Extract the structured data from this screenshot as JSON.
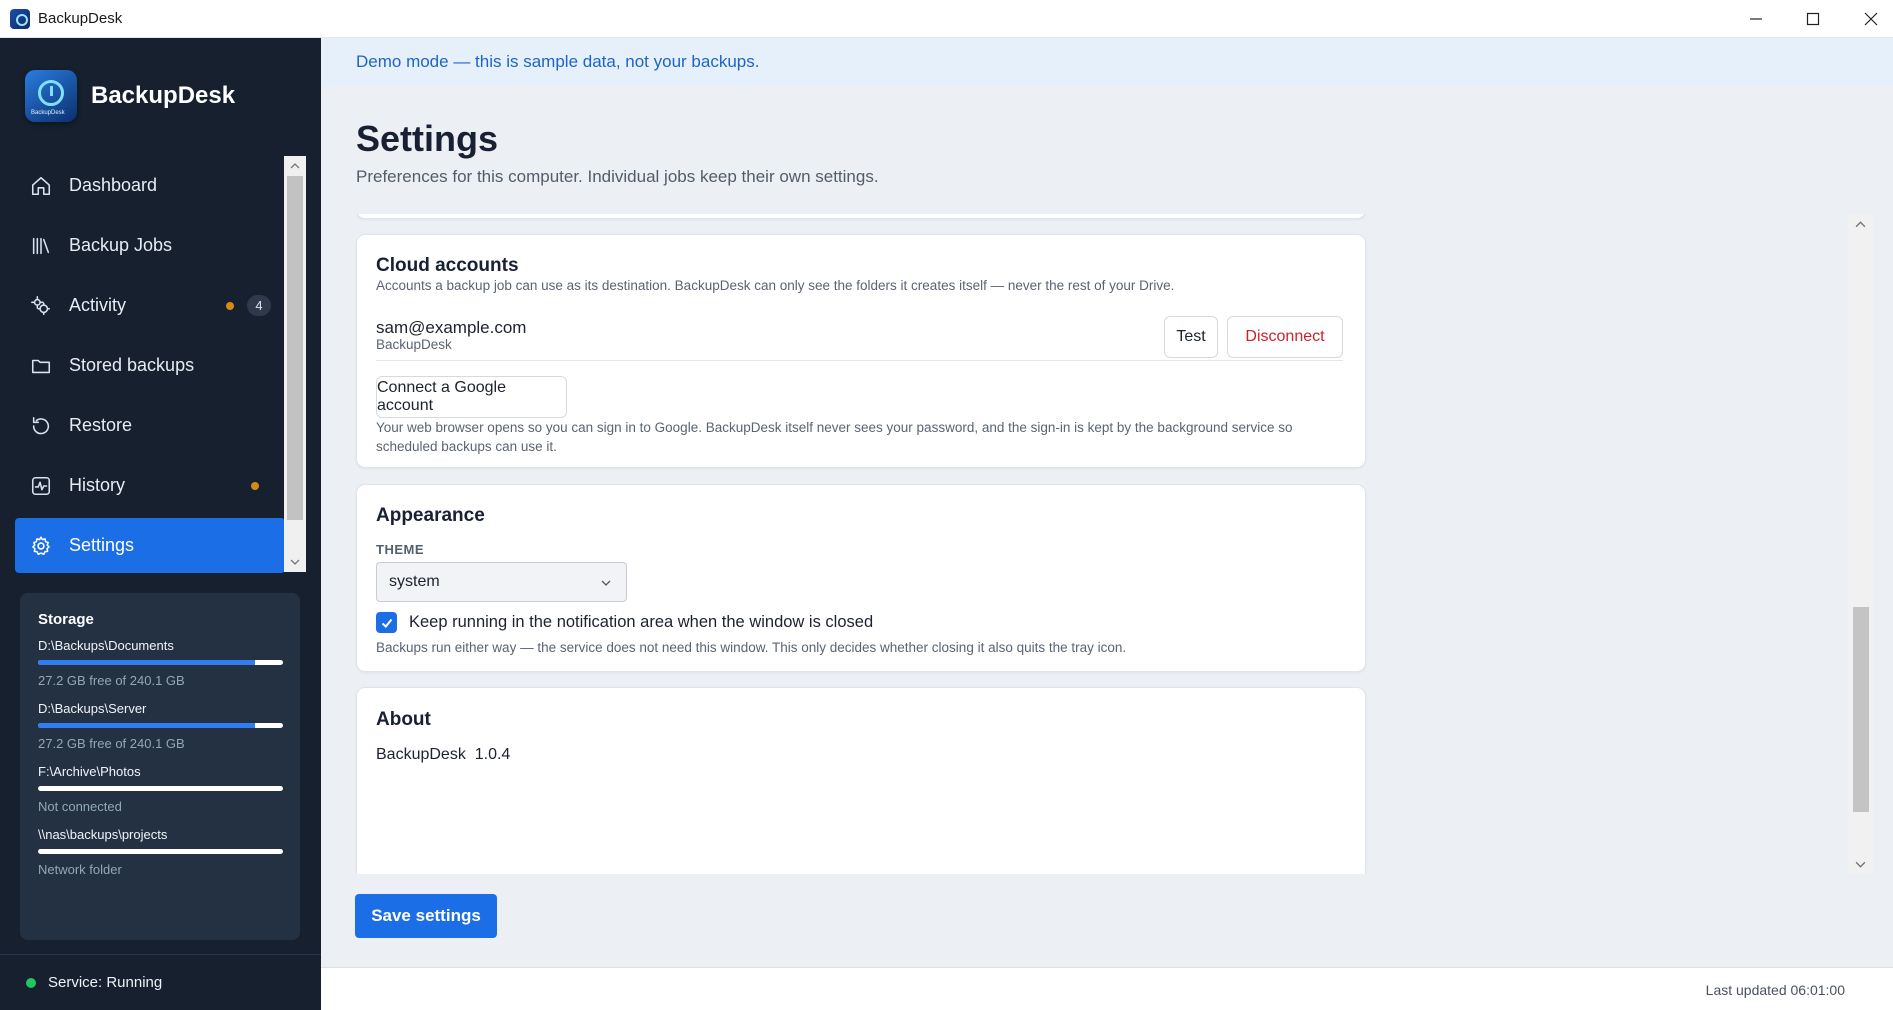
{
  "window": {
    "title": "BackupDesk"
  },
  "sidebar": {
    "brand": "BackupDesk",
    "brand_logo_caption": "BackupDesk",
    "nav": [
      {
        "label": "Dashboard",
        "icon": "home-icon"
      },
      {
        "label": "Backup Jobs",
        "icon": "library-icon"
      },
      {
        "label": "Activity",
        "icon": "cogs-icon",
        "dot": true,
        "badge": "4"
      },
      {
        "label": "Stored backups",
        "icon": "folder-icon"
      },
      {
        "label": "Restore",
        "icon": "restore-icon"
      },
      {
        "label": "History",
        "icon": "pulse-icon",
        "dot": true
      },
      {
        "label": "Settings",
        "icon": "gear-icon",
        "active": true
      }
    ],
    "storage": {
      "title": "Storage",
      "volumes": [
        {
          "path": "D:\\Backups\\Documents",
          "info": "27.2 GB free of 240.1 GB",
          "used_fraction": 0.887
        },
        {
          "path": "D:\\Backups\\Server",
          "info": "27.2 GB free of 240.1 GB",
          "used_fraction": 0.887
        },
        {
          "path": "F:\\Archive\\Photos",
          "info": "Not connected",
          "used_fraction": 0
        },
        {
          "path": "\\\\nas\\backups\\projects",
          "info": "Network folder",
          "used_fraction": 0
        }
      ]
    },
    "service_status": "Service: Running",
    "colors": {
      "background": "#16202f",
      "active": "#1c6ee6",
      "dot": "#d68a16",
      "service_ok": "#22c55e"
    }
  },
  "main": {
    "demo_banner": "Demo mode — this is sample data, not your backups.",
    "title": "Settings",
    "subtitle": "Preferences for this computer. Individual jobs keep their own settings.",
    "cloud": {
      "title": "Cloud accounts",
      "description": "Accounts a backup job can use as its destination. BackupDesk can only see the folders it creates itself — never the rest of your Drive.",
      "account_email": "sam@example.com",
      "account_folder": "BackupDesk",
      "test_label": "Test",
      "disconnect_label": "Disconnect",
      "connect_label": "Connect a Google account",
      "note": "Your web browser opens so you can sign in to Google. BackupDesk itself never sees your password, and the sign-in is kept by the background service so scheduled backups can use it."
    },
    "appearance": {
      "title": "Appearance",
      "theme_label": "THEME",
      "theme_value": "system",
      "tray_checked": true,
      "tray_label": "Keep running in the notification area when the window is closed",
      "tray_note": "Backups run either way — the service does not need this window. This only decides whether closing it also quits the tray icon."
    },
    "about": {
      "title": "About",
      "app_name": "BackupDesk",
      "version": "1.0.4"
    },
    "save_label": "Save settings",
    "last_updated": "Last updated 06:01:00"
  }
}
